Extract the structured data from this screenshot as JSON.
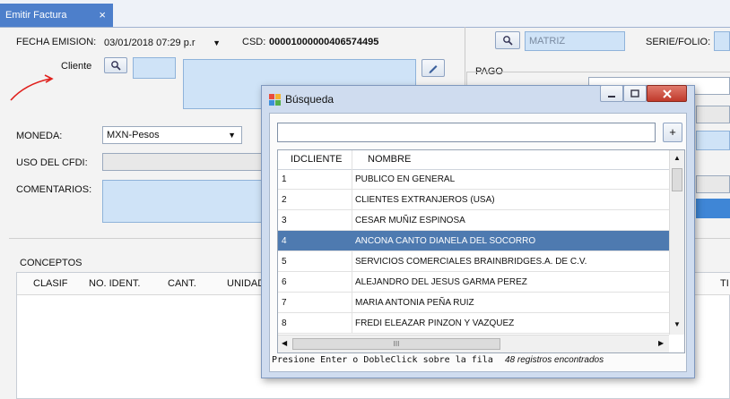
{
  "tab": {
    "label": "Emitir Factura",
    "close": "×"
  },
  "form": {
    "fecha_label": "FECHA EMISION:",
    "fecha_value": "03/01/2018 07:29 p.r",
    "csd_label": "CSD:",
    "csd_value": "00001000000406574495",
    "cliente_label": "Cliente",
    "moneda_label": "MONEDA:",
    "moneda_value": "MXN-Pesos",
    "uso_cfdi_label": "USO DEL CFDI:",
    "comentarios_label": "COMENTARIOS:",
    "matriz_value": "MATRIZ",
    "serie_label": "SERIE/FOLIO:",
    "pago_label": "PAGO"
  },
  "conceptos": {
    "label": "CONCEPTOS",
    "columns": [
      "CLASIF",
      "NO. IDENT.",
      "CANT.",
      "UNIDAD"
    ],
    "right_col": "TI"
  },
  "dialog": {
    "title": "Búsqueda",
    "add_label": "+",
    "columns": [
      "IDCLIENTE",
      "NOMBRE"
    ],
    "rows": [
      {
        "id": "1",
        "name": "PUBLICO EN GENERAL"
      },
      {
        "id": "2",
        "name": "CLIENTES EXTRANJEROS (USA)"
      },
      {
        "id": "3",
        "name": "CESAR MUÑIZ ESPINOSA"
      },
      {
        "id": "4",
        "name": "ANCONA CANTO DIANELA DEL SOCORRO"
      },
      {
        "id": "5",
        "name": "SERVICIOS COMERCIALES BRAINBRIDGES.A. DE C.V."
      },
      {
        "id": "6",
        "name": "ALEJANDRO DEL JESUS GARMA PEREZ"
      },
      {
        "id": "7",
        "name": "MARIA ANTONIA PEÑA RUIZ"
      },
      {
        "id": "8",
        "name": "FREDI ELEAZAR PINZON Y VAZQUEZ"
      }
    ],
    "selected_row": 4,
    "hscroll_grip": "III",
    "footer_hint": "Presione Enter o DobleClick sobre la fila",
    "footer_count": "48 registros encontrados"
  },
  "colors": {
    "accent": "#4d7fcb",
    "selected_row": "#4e7ab0",
    "input_bg": "#cfe3f7",
    "annotation": "#e0201c"
  },
  "icons": {
    "search": "search-icon",
    "edit": "pencil-icon",
    "app": "app-icon",
    "minimize": "minimize-icon",
    "maximize": "maximize-icon",
    "close": "close-icon"
  }
}
